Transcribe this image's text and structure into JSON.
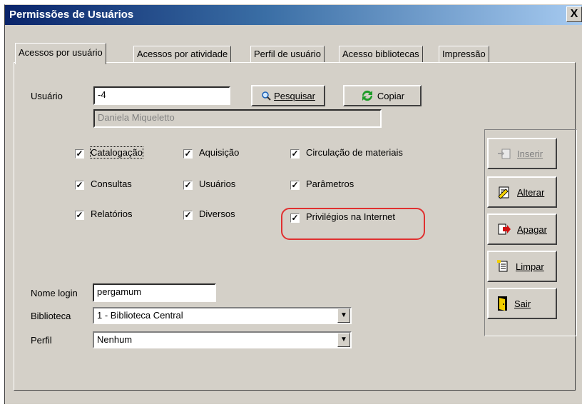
{
  "window": {
    "title": "Permissões de Usuários",
    "close": "X"
  },
  "tabs": [
    {
      "label": "Acessos por usuário",
      "active": true
    },
    {
      "label": "Acessos por atividade",
      "active": false
    },
    {
      "label": "Perfil de usuário",
      "active": false
    },
    {
      "label": "Acesso bibliotecas",
      "active": false
    },
    {
      "label": "Impressão",
      "active": false
    }
  ],
  "user": {
    "label": "Usuário",
    "value": "-4",
    "name_display": "Daniela Miqueletto",
    "search_button": "Pesquisar",
    "copy_button": "Copiar"
  },
  "checkboxes": [
    {
      "label": "Catalogação",
      "checked": true
    },
    {
      "label": "Aquisição",
      "checked": true
    },
    {
      "label": "Circulação de materiais",
      "checked": true
    },
    {
      "label": "Consultas",
      "checked": true
    },
    {
      "label": "Usuários",
      "checked": true
    },
    {
      "label": "Parâmetros",
      "checked": true
    },
    {
      "label": "Relatórios",
      "checked": true
    },
    {
      "label": "Diversos",
      "checked": true
    },
    {
      "label": "Privilégios na Internet",
      "checked": true
    }
  ],
  "login": {
    "label": "Nome login",
    "value": "pergamum"
  },
  "library": {
    "label": "Biblioteca",
    "value": "1 - Biblioteca Central"
  },
  "profile": {
    "label": "Perfil",
    "value": "Nenhum"
  },
  "actions": {
    "insert": "Inserir",
    "edit": "Alterar",
    "delete": "Apagar",
    "clear": "Limpar",
    "exit": "Sair"
  },
  "icons": {
    "search": "magnifier-icon",
    "copy": "refresh-icon",
    "insert": "insert-icon",
    "edit": "edit-icon",
    "delete": "delete-icon",
    "clear": "clear-icon",
    "exit": "exit-door-icon"
  },
  "colors": {
    "titlebar": "#0a246a",
    "highlight": "#e03030",
    "face": "#d4d0c8"
  }
}
